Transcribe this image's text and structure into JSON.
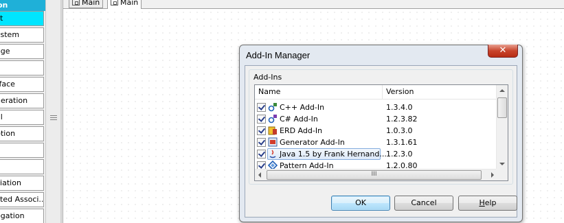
{
  "palette": {
    "header": "on",
    "items": [
      "ct",
      "ystem",
      "age",
      "s",
      "rface",
      "neration",
      "al",
      "ption",
      "",
      "",
      "ciation",
      "cted Associ...",
      "egation"
    ],
    "selected_index": 0
  },
  "tabs": [
    {
      "label": "Main",
      "active": false
    },
    {
      "label": "Main",
      "active": true
    }
  ],
  "dialog": {
    "title": "Add-In Manager",
    "close_glyph": "✕",
    "group_label": "Add-Ins",
    "columns": [
      "Name",
      "Version"
    ],
    "rows": [
      {
        "name": "C++ Add-In",
        "version": "1.3.4.0",
        "checked": true,
        "icon": "cpp-addin-icon"
      },
      {
        "name": "C# Add-In",
        "version": "1.2.3.82",
        "checked": true,
        "icon": "csharp-addin-icon"
      },
      {
        "name": "ERD Add-In",
        "version": "1.0.3.0",
        "checked": true,
        "icon": "erd-addin-icon"
      },
      {
        "name": "Generator Add-In",
        "version": "1.3.1.61",
        "checked": true,
        "icon": "generator-addin-icon"
      },
      {
        "name": "Java 1.5 by Frank Hernand...",
        "version": "1.2.3.0",
        "checked": true,
        "icon": "java-addin-icon",
        "selected": true
      },
      {
        "name": "Pattern Add-In",
        "version": "1.2.0.80",
        "checked": true,
        "icon": "pattern-addin-icon"
      }
    ],
    "hscroll_grip": "III",
    "buttons": {
      "ok": "OK",
      "cancel": "Cancel",
      "help_prefix": "H",
      "help_rest": "elp"
    }
  },
  "colors": {
    "palette_header": "#1fb0d8",
    "palette_selected": "#00e5ff",
    "close_button": "#c8442c",
    "selection": "#dde9f9"
  }
}
